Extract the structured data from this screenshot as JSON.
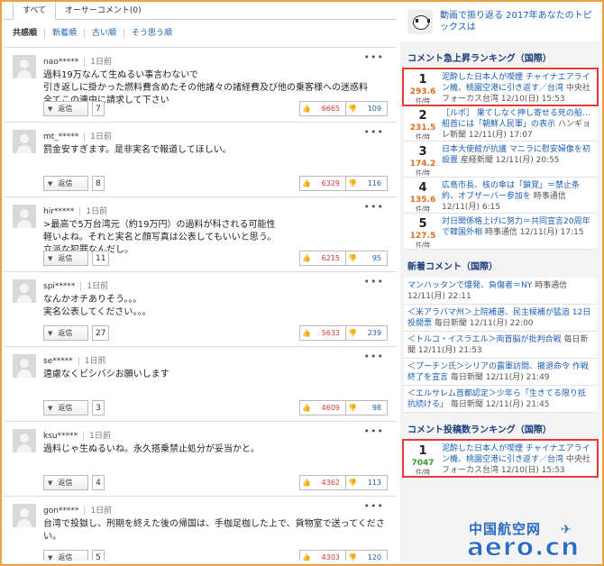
{
  "tabs": [
    {
      "label": "すべて"
    },
    {
      "label": "オーサーコメント(0)"
    }
  ],
  "sort_options": [
    {
      "label": "共感順"
    },
    {
      "label": "新着順"
    },
    {
      "label": "古い順"
    },
    {
      "label": "そう思う順"
    }
  ],
  "comments": [
    {
      "user": "nao*****",
      "time": "1日前",
      "lines": [
        "過料19万なんて生ぬるい事言わないで",
        "引き返しに掛かった燃料費含めたその他諸々の諸経費及び他の乗客様への迷惑料",
        "全てこの連中に請求して下さい"
      ],
      "reply_label": "返信",
      "reply_count": "7",
      "likes": "6665",
      "dislikes": "109"
    },
    {
      "user": "mt_*****",
      "time": "1日前",
      "lines": [
        "罰金安すぎます。是非実名で報道してほしい。"
      ],
      "reply_label": "返信",
      "reply_count": "8",
      "likes": "6329",
      "dislikes": "116"
    },
    {
      "user": "hir*****",
      "time": "1日前",
      "lines": [
        ">最高で5万台湾元（約19万円）の過料が科される可能性",
        "軽いよね。それと実名と顔写真は公表してもいいと思う。",
        "立派な犯罪なんだし。"
      ],
      "reply_label": "返信",
      "reply_count": "11",
      "likes": "6215",
      "dislikes": "95"
    },
    {
      "user": "spi*****",
      "time": "1日前",
      "lines": [
        "なんかオチありそう。。。",
        "実名公表してください。。。"
      ],
      "reply_label": "返信",
      "reply_count": "27",
      "likes": "5633",
      "dislikes": "239"
    },
    {
      "user": "se*****",
      "time": "1日前",
      "lines": [
        "遠慮なくビシバシお願いします"
      ],
      "reply_label": "返信",
      "reply_count": "3",
      "likes": "4609",
      "dislikes": "98"
    },
    {
      "user": "ksu*****",
      "time": "1日前",
      "lines": [
        "過料じゃ生ぬるいね。永久搭乗禁止処分が妥当かと。"
      ],
      "reply_label": "返信",
      "reply_count": "4",
      "likes": "4362",
      "dislikes": "113"
    },
    {
      "user": "gon*****",
      "time": "1日前",
      "lines": [
        "台湾で投獄し、刑期を終えた後の帰国は、手枷足枷した上で、貨物室で送ってください。"
      ],
      "reply_label": "返信",
      "reply_count": "5",
      "likes": "4303",
      "dislikes": "120"
    }
  ],
  "sidebar": {
    "promo": "動画で振り返る 2017年あなたのトピックスは",
    "ranking_title": "コメント急上昇ランキング（国際）",
    "ranking_unit": "件/時",
    "ranking": [
      {
        "rank": "1",
        "score": "293.6",
        "title": "泥酔した日本人が喫煙 チャイナエアライン機、桃園空港に引き返す／台湾",
        "source": "中央社フォーカス台湾",
        "date": "12/10(日) 15:53"
      },
      {
        "rank": "2",
        "score": "231.5",
        "title": "［ルポ］ 果てしなく押し寄せる死の船…船首には「朝鮮人民軍」の表示",
        "source": "ハンギョレ新聞",
        "date": "12/11(月) 17:07"
      },
      {
        "rank": "3",
        "score": "174.2",
        "title": "日本大使館が抗議 マニラに慰安婦像を初設置",
        "source": "産経新聞",
        "date": "12/11(月) 20:55"
      },
      {
        "rank": "4",
        "score": "135.6",
        "title": "広島市長、核の傘は「鎖覚」＝禁止条約、オブザーバー参加を",
        "source": "時事通信",
        "date": "12/11(月) 6:15"
      },
      {
        "rank": "5",
        "score": "127.5",
        "title": "対日関係格上げに努力＝共同宣言20周年で韓国外相",
        "source": "時事通信",
        "date": "12/11(月) 17:15"
      }
    ],
    "new_title": "新着コメント（国際）",
    "new_items": [
      {
        "title": "マンハッタンで爆発、負傷者＝NY",
        "source": "時事通信",
        "date": "12/11(月) 22:11"
      },
      {
        "title": "＜米アラバマ州＞上院補選、民主候補が猛追 12日投開票",
        "source": "毎日新聞",
        "date": "12/11(月) 22:00"
      },
      {
        "title": "＜トルコ・イスラエル＞両首脳が批判合戦",
        "source": "毎日新聞",
        "date": "12/11(月) 21:53"
      },
      {
        "title": "＜プーチン氏＞シリアの露軍訪問、撤退命令 作戦終了を宣言",
        "source": "毎日新聞",
        "date": "12/11(月) 21:49"
      },
      {
        "title": "＜エルサレム首都認定＞少年ら「生きてる限り抵抗続ける」",
        "source": "毎日新聞",
        "date": "12/11(月) 21:45"
      }
    ],
    "count_title": "コメント投稿数ランキング（国際）",
    "count_ranking": [
      {
        "rank": "1",
        "score": "7047",
        "title": "泥酔した日本人が喫煙 チャイナエアライン機、桃園空港に引き返す／台湾",
        "source": "中央社フォーカス台湾",
        "date": "12/10(日) 15:53"
      }
    ]
  },
  "watermark": {
    "cn": "中国航空网",
    "en": "aero.cn"
  },
  "colors": {
    "accent_link": "#1a5fb4",
    "like": "#d9363e",
    "dislike": "#1a5fb4",
    "score_orange": "#e06c1a",
    "score_green": "#3a9a2a",
    "highlight": "#e53a3a",
    "frame": "#f0a040"
  }
}
